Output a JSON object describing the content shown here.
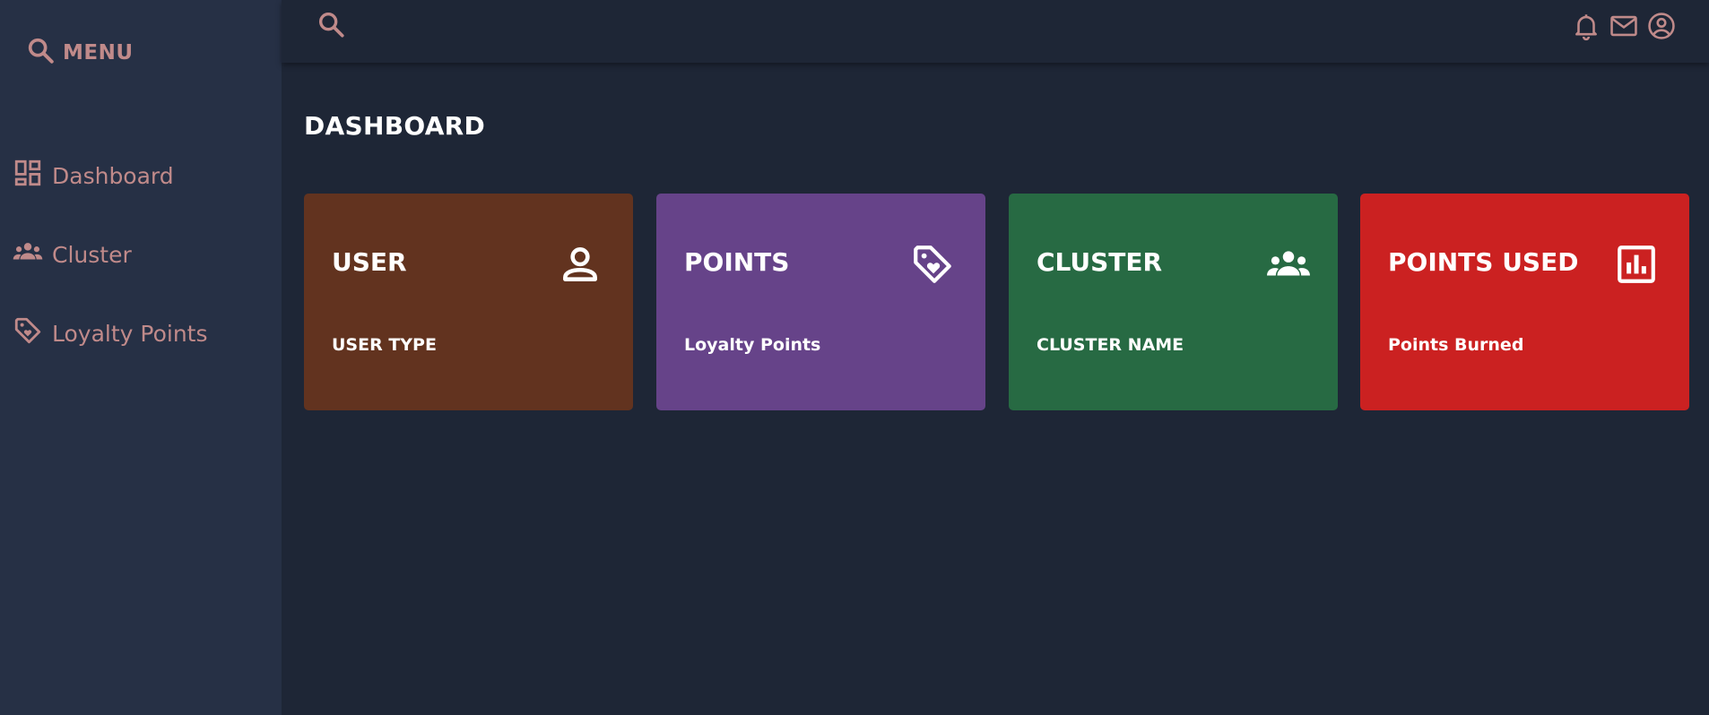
{
  "sidebar": {
    "menu_label": "MENU",
    "items": [
      {
        "label": "Dashboard",
        "icon": "dashboard-icon"
      },
      {
        "label": "Cluster",
        "icon": "groups-icon"
      },
      {
        "label": "Loyalty Points",
        "icon": "tag-heart-icon"
      }
    ]
  },
  "topbar": {
    "icons": [
      "search-icon",
      "bell-icon",
      "mail-icon",
      "account-circle-icon"
    ]
  },
  "main": {
    "title": "DASHBOARD",
    "cards": [
      {
        "title": "USER",
        "subtitle": "USER TYPE",
        "icon": "person-icon",
        "color": "#62331f"
      },
      {
        "title": "POINTS",
        "subtitle": "Loyalty Points",
        "icon": "tag-heart-icon",
        "color": "#664389"
      },
      {
        "title": "CLUSTER",
        "subtitle": "CLUSTER NAME",
        "icon": "groups-icon",
        "color": "#276a43"
      },
      {
        "title": "POINTS USED",
        "subtitle": "Points Burned",
        "icon": "bar-chart-icon",
        "color": "#cb2121"
      }
    ]
  },
  "colors": {
    "background": "#1e2636",
    "sidebar": "#263045",
    "accent_text": "#c08a8a"
  }
}
